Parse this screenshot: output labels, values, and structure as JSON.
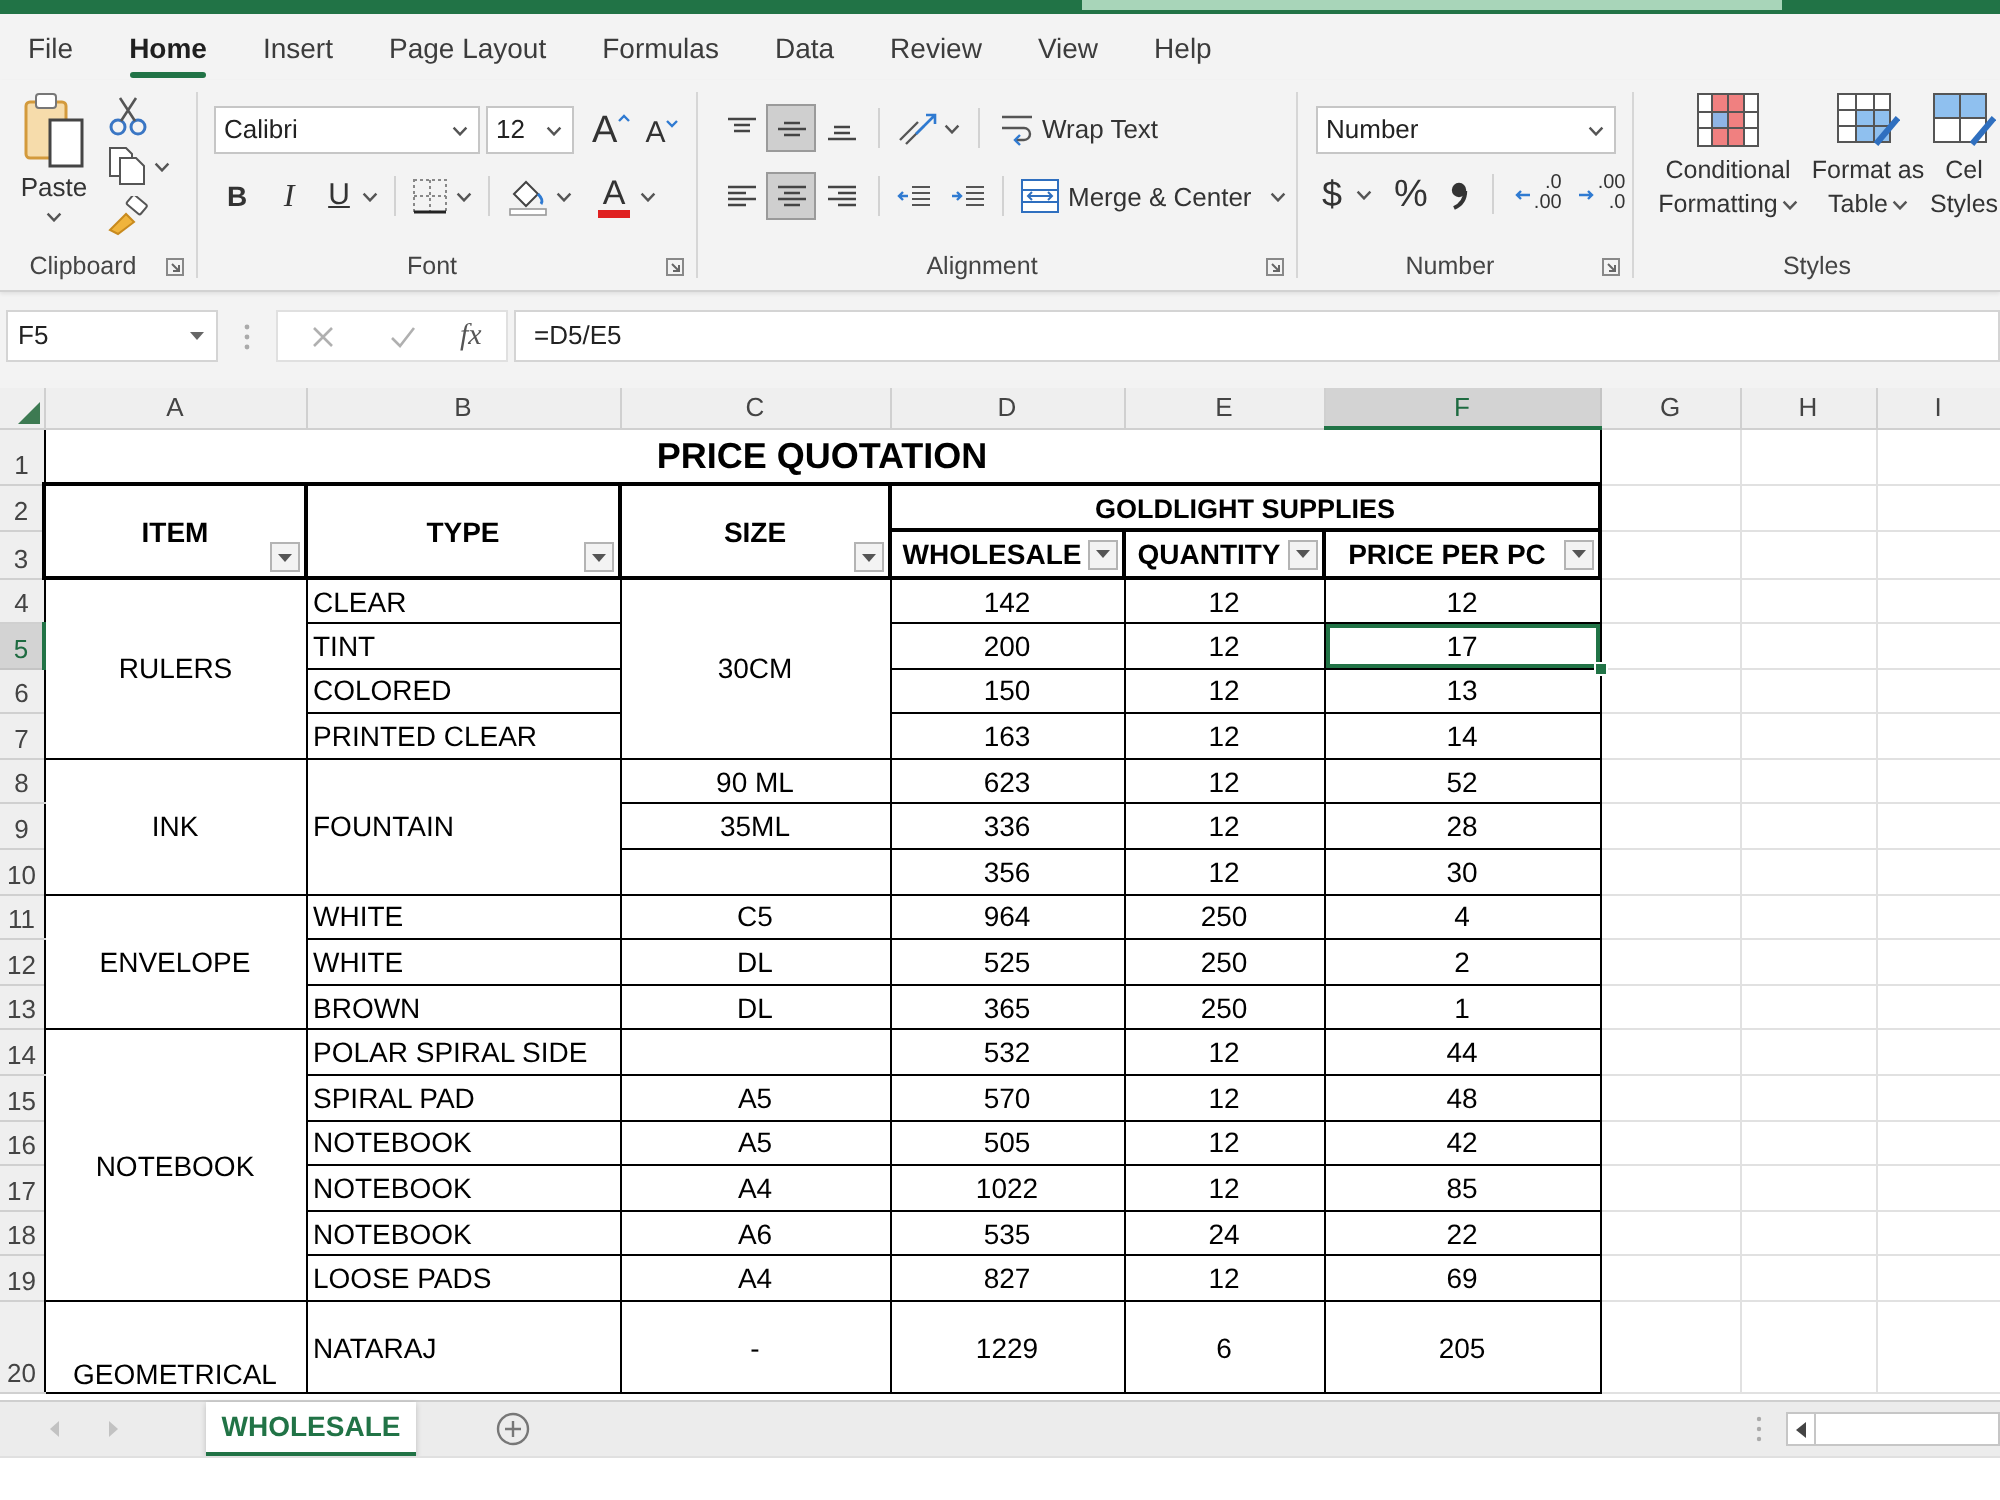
{
  "menu_tabs": [
    {
      "label": "File",
      "selected": false
    },
    {
      "label": "Home",
      "selected": true
    },
    {
      "label": "Insert",
      "selected": false
    },
    {
      "label": "Page Layout",
      "selected": false
    },
    {
      "label": "Formulas",
      "selected": false
    },
    {
      "label": "Data",
      "selected": false
    },
    {
      "label": "Review",
      "selected": false
    },
    {
      "label": "View",
      "selected": false
    },
    {
      "label": "Help",
      "selected": false
    }
  ],
  "ribbon": {
    "clipboard": {
      "label": "Clipboard",
      "paste": "Paste"
    },
    "font": {
      "label": "Font",
      "font_name": "Calibri",
      "font_size": "12",
      "grow": "A",
      "shrink": "A",
      "bold": "B",
      "italic": "I",
      "underline": "U",
      "font_color": "A"
    },
    "alignment": {
      "label": "Alignment",
      "buttons": [
        {
          "kind": "top",
          "selected": false
        },
        {
          "kind": "middle",
          "selected": true
        },
        {
          "kind": "bottom",
          "selected": false
        },
        {
          "kind": "left",
          "selected": false
        },
        {
          "kind": "center",
          "selected": true
        },
        {
          "kind": "right",
          "selected": false
        }
      ],
      "wrap_text": "Wrap Text",
      "merge": "Merge & Center"
    },
    "number": {
      "label": "Number",
      "format": "Number",
      "currency": "$",
      "percent": "%",
      "decimals": [
        {
          "kind": "increase",
          "top": ".0",
          "bottom": ".00"
        },
        {
          "kind": "decrease",
          "top": ".00",
          "bottom": ".0"
        }
      ]
    },
    "styles": {
      "label": "Styles",
      "buttons": [
        {
          "kind": "conditional",
          "lines": [
            "Conditional",
            "Formatting"
          ],
          "dropdown": true
        },
        {
          "kind": "table",
          "lines": [
            "Format as",
            "Table"
          ],
          "dropdown": true
        },
        {
          "kind": "cell",
          "lines": [
            "Cel",
            "Styles"
          ],
          "dropdown": false
        }
      ]
    }
  },
  "formula_bar": {
    "name_box": "F5",
    "function": "fx",
    "formula": "=D5/E5"
  },
  "sheet": {
    "columns": [
      {
        "label": "A",
        "selected": false
      },
      {
        "label": "B",
        "selected": false
      },
      {
        "label": "C",
        "selected": false
      },
      {
        "label": "D",
        "selected": false
      },
      {
        "label": "E",
        "selected": false
      },
      {
        "label": "F",
        "selected": true
      },
      {
        "label": "G",
        "selected": false
      },
      {
        "label": "H",
        "selected": false
      },
      {
        "label": "I",
        "selected": false
      }
    ],
    "title_row": {
      "label": "1",
      "selected": false,
      "title": "PRICE QUOTATION"
    },
    "heading_rows": [
      {
        "label": "2",
        "selected": false
      },
      {
        "label": "3",
        "selected": false
      }
    ],
    "group_heading": "GOLDLIGHT SUPPLIES",
    "headings": [
      {
        "text": "ITEM",
        "kind": "tall"
      },
      {
        "text": "TYPE",
        "kind": "tall"
      },
      {
        "text": "SIZE",
        "kind": "tall"
      },
      {
        "text": "WHOLESALE",
        "kind": "grouped"
      },
      {
        "text": "QUANTITY",
        "kind": "grouped"
      },
      {
        "text": "PRICE PER PC",
        "kind": "grouped"
      }
    ],
    "rows": [
      {
        "label": "4",
        "selected": false,
        "cells": [
          {
            "text": "RULERS",
            "rowspan": 4
          },
          "CLEAR",
          {
            "text": "30CM",
            "rowspan": 4
          },
          "142",
          "12",
          "12"
        ]
      },
      {
        "label": "5",
        "selected": true,
        "cells": [
          "TINT",
          "200",
          "12",
          "17"
        ]
      },
      {
        "label": "6",
        "selected": false,
        "cells": [
          "COLORED",
          "150",
          "12",
          "13"
        ]
      },
      {
        "label": "7",
        "selected": false,
        "cells": [
          "PRINTED CLEAR",
          "163",
          "12",
          "14"
        ]
      },
      {
        "label": "8",
        "selected": false,
        "cells": [
          {
            "text": "INK",
            "rowspan": 3
          },
          {
            "text": "FOUNTAIN",
            "rowspan": 3
          },
          "90 ML",
          "623",
          "12",
          "52"
        ]
      },
      {
        "label": "9",
        "selected": false,
        "cells": [
          "35ML",
          "336",
          "12",
          "28"
        ]
      },
      {
        "label": "10",
        "selected": false,
        "cells": [
          {
            "kind": "blank"
          },
          "356",
          "12",
          "30"
        ]
      },
      {
        "label": "11",
        "selected": false,
        "cells": [
          {
            "text": "ENVELOPE",
            "rowspan": 3
          },
          "WHITE",
          "C5",
          "964",
          "250",
          "4"
        ]
      },
      {
        "label": "12",
        "selected": false,
        "cells": [
          "WHITE",
          "DL",
          "525",
          "250",
          "2"
        ]
      },
      {
        "label": "13",
        "selected": false,
        "cells": [
          "BROWN",
          "DL",
          "365",
          "250",
          "1"
        ]
      },
      {
        "label": "14",
        "selected": false,
        "cells": [
          {
            "text": "NOTEBOOK",
            "rowspan": 6
          },
          "POLAR SPIRAL SIDE",
          {
            "kind": "blank"
          },
          "532",
          "12",
          "44"
        ]
      },
      {
        "label": "15",
        "selected": false,
        "cells": [
          "SPIRAL PAD",
          "A5",
          "570",
          "12",
          "48"
        ]
      },
      {
        "label": "16",
        "selected": false,
        "cells": [
          "NOTEBOOK",
          "A5",
          "505",
          "12",
          "42"
        ]
      },
      {
        "label": "17",
        "selected": false,
        "cells": [
          "NOTEBOOK",
          "A4",
          "1022",
          "12",
          "85"
        ]
      },
      {
        "label": "18",
        "selected": false,
        "cells": [
          "NOTEBOOK",
          "A6",
          "535",
          "24",
          "22"
        ]
      },
      {
        "label": "19",
        "selected": false,
        "cells": [
          "LOOSE PADS",
          "A4",
          "827",
          "12",
          "69"
        ]
      },
      {
        "label": "20",
        "selected": false,
        "cells": [
          "GEOMETRICAL",
          "NATARAJ",
          "-",
          "1229",
          "6",
          "205"
        ]
      }
    ]
  },
  "sheet_tabs": [
    {
      "label": "WHOLESALE",
      "selected": true
    }
  ]
}
